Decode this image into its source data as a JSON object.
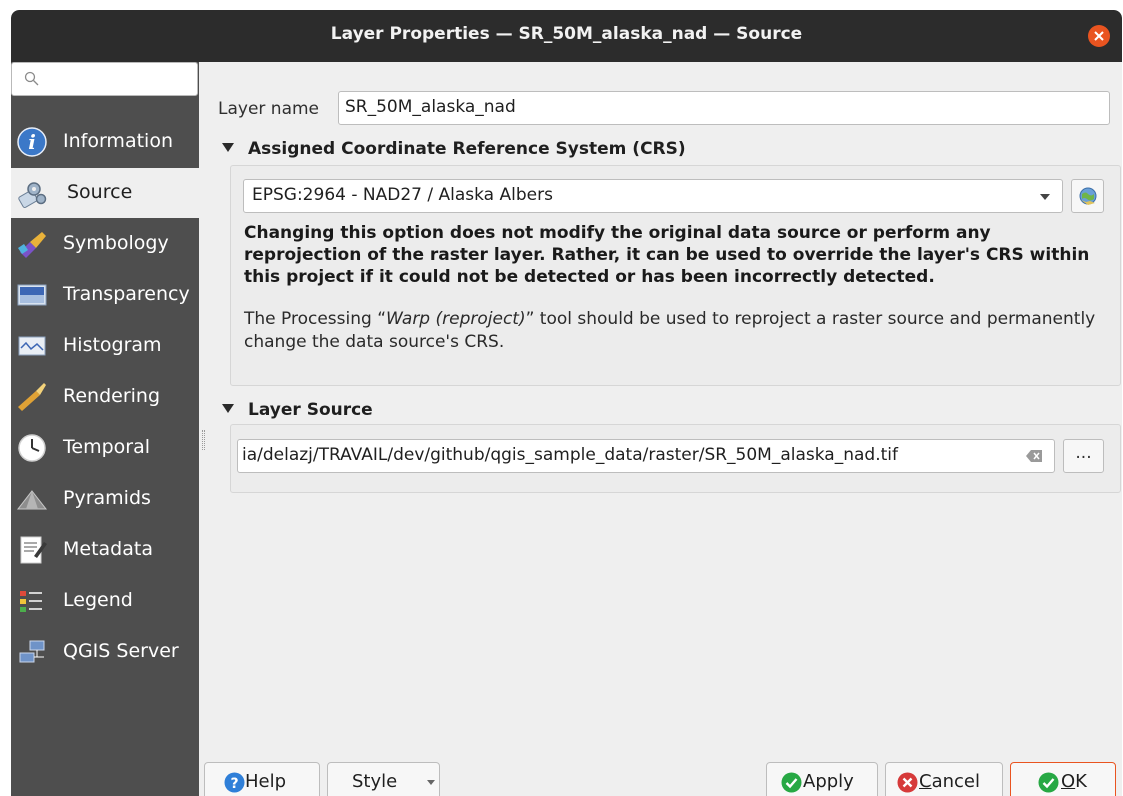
{
  "window": {
    "title": "Layer Properties — SR_50M_alaska_nad — Source"
  },
  "sidebar": {
    "search_placeholder": "",
    "items": [
      {
        "label": "Information",
        "icon": "information-icon",
        "active": false
      },
      {
        "label": "Source",
        "icon": "source-icon",
        "active": true
      },
      {
        "label": "Symbology",
        "icon": "symbology-icon",
        "active": false
      },
      {
        "label": "Transparency",
        "icon": "transparency-icon",
        "active": false
      },
      {
        "label": "Histogram",
        "icon": "histogram-icon",
        "active": false
      },
      {
        "label": "Rendering",
        "icon": "rendering-icon",
        "active": false
      },
      {
        "label": "Temporal",
        "icon": "temporal-icon",
        "active": false
      },
      {
        "label": "Pyramids",
        "icon": "pyramids-icon",
        "active": false
      },
      {
        "label": "Metadata",
        "icon": "metadata-icon",
        "active": false
      },
      {
        "label": "Legend",
        "icon": "legend-icon",
        "active": false
      },
      {
        "label": "QGIS Server",
        "icon": "qgis-server-icon",
        "active": false
      }
    ]
  },
  "main": {
    "layer_name_label": "Layer name",
    "layer_name_value": "SR_50M_alaska_nad",
    "crs_section": {
      "title": "Assigned Coordinate Reference System (CRS)",
      "selected_crs": "EPSG:2964 - NAD27 / Alaska Albers",
      "warning": "Changing this option does not modify the original data source or perform any reprojection of the raster layer. Rather, it can be used to override the layer's CRS within this project if it could not be detected or has been incorrectly detected.",
      "note_before": "The Processing “",
      "note_tool": "Warp (reproject)",
      "note_after": "” tool should be used to reproject a raster source and permanently change the data source's CRS."
    },
    "source_section": {
      "title": "Layer Source",
      "path": "ia/delazj/TRAVAIL/dev/github/qgis_sample_data/raster/SR_50M_alaska_nad.tif",
      "browse_label": "..."
    }
  },
  "buttons": {
    "help": "Help",
    "style": "Style",
    "apply": "Apply",
    "cancel_pre": "",
    "cancel_mnemonic": "C",
    "cancel_post": "ancel",
    "ok_mnemonic": "O",
    "ok_post": "K"
  },
  "colors": {
    "accent": "#e95420",
    "sidebar_bg": "#4e4e4e",
    "titlebar_bg": "#2c2c2c",
    "apply_green": "#27a844",
    "cancel_red": "#d63a3a",
    "help_blue": "#2f7fd8"
  }
}
